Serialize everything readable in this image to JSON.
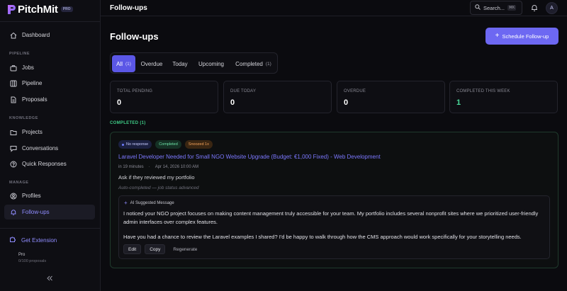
{
  "brand": {
    "name": "PitchMit",
    "badge": "PRO"
  },
  "sidebar": {
    "items": [
      {
        "label": "Dashboard",
        "icon": "home-icon"
      },
      {
        "label": "Jobs",
        "icon": "briefcase-icon"
      },
      {
        "label": "Pipeline",
        "icon": "columns-icon"
      },
      {
        "label": "Proposals",
        "icon": "file-text-icon"
      },
      {
        "label": "Projects",
        "icon": "folder-icon"
      },
      {
        "label": "Conversations",
        "icon": "chat-icon"
      },
      {
        "label": "Quick Responses",
        "icon": "help-circle-icon"
      },
      {
        "label": "Profiles",
        "icon": "user-circle-icon"
      },
      {
        "label": "Follow-ups",
        "icon": "bell-icon",
        "active": true
      }
    ],
    "sections": {
      "pipeline": "PIPELINE",
      "knowledge": "KNOWLEDGE",
      "manage": "MANAGE"
    },
    "extension": "Get Extension",
    "plan": {
      "name": "Pro",
      "count": "0/100 proposals"
    }
  },
  "topbar": {
    "title": "Follow-ups",
    "search_label": "Search...",
    "search_kbd": "⌘K",
    "avatar": "A"
  },
  "page": {
    "title": "Follow-ups",
    "schedule_label": "Schedule Follow-up"
  },
  "tabs": [
    {
      "label": "All",
      "count": "(1)",
      "active": true
    },
    {
      "label": "Overdue",
      "count": ""
    },
    {
      "label": "Today",
      "count": ""
    },
    {
      "label": "Upcoming",
      "count": ""
    },
    {
      "label": "Completed",
      "count": "(1)"
    }
  ],
  "stats": [
    {
      "label": "TOTAL PENDING",
      "value": "0"
    },
    {
      "label": "DUE TODAY",
      "value": "0"
    },
    {
      "label": "OVERDUE",
      "value": "0"
    },
    {
      "label": "COMPLETED THIS WEEK",
      "value": "1"
    }
  ],
  "section_label": "COMPLETED (1)",
  "followup": {
    "badges": {
      "response": "No response",
      "status": "Completed",
      "snoozed": "Snoozed 1x"
    },
    "job_title": "Laravel Developer Needed for Small NGO Website Upgrade (Budget: €1,000 Fixed) - Web Development",
    "due_relative": "in 19 minutes",
    "due_date": "Apr 14, 2026 10:00 AM",
    "note": "Ask if they reviewed my portfolio",
    "auto_note": "Auto-completed — job status advanced",
    "ai": {
      "heading": "AI Suggested Message",
      "paragraph1": "I noticed your NGO project focuses on making content management truly accessible for your team. My portfolio includes several nonprofit sites where we prioritized user-friendly admin interfaces over complex features.",
      "paragraph2": "Have you had a chance to review the Laravel examples I shared? I'd be happy to walk through how the CMS approach would work specifically for your storytelling needs.",
      "edit_label": "Edit",
      "copy_label": "Copy",
      "regenerate_label": "Regenerate"
    }
  },
  "colors": {
    "accent": "#6d68f2",
    "success": "#3ecb86",
    "link": "#7c78ff"
  }
}
